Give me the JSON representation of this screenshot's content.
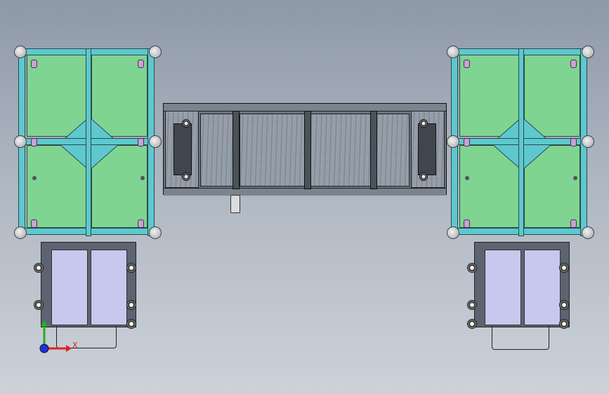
{
  "view": {
    "background_top": "#8e99a8",
    "background_bottom": "#cdd2d9"
  },
  "triad": {
    "x_label": "X",
    "x_color": "#e02020",
    "y_color": "#20b020",
    "z_color": "#2030e0"
  },
  "colors": {
    "frame": "#5ec8cf",
    "panel": "#7fd492",
    "hinge": "#c9a2d6",
    "bin": "#c7c8ee",
    "cabinet": "#6c7580"
  }
}
